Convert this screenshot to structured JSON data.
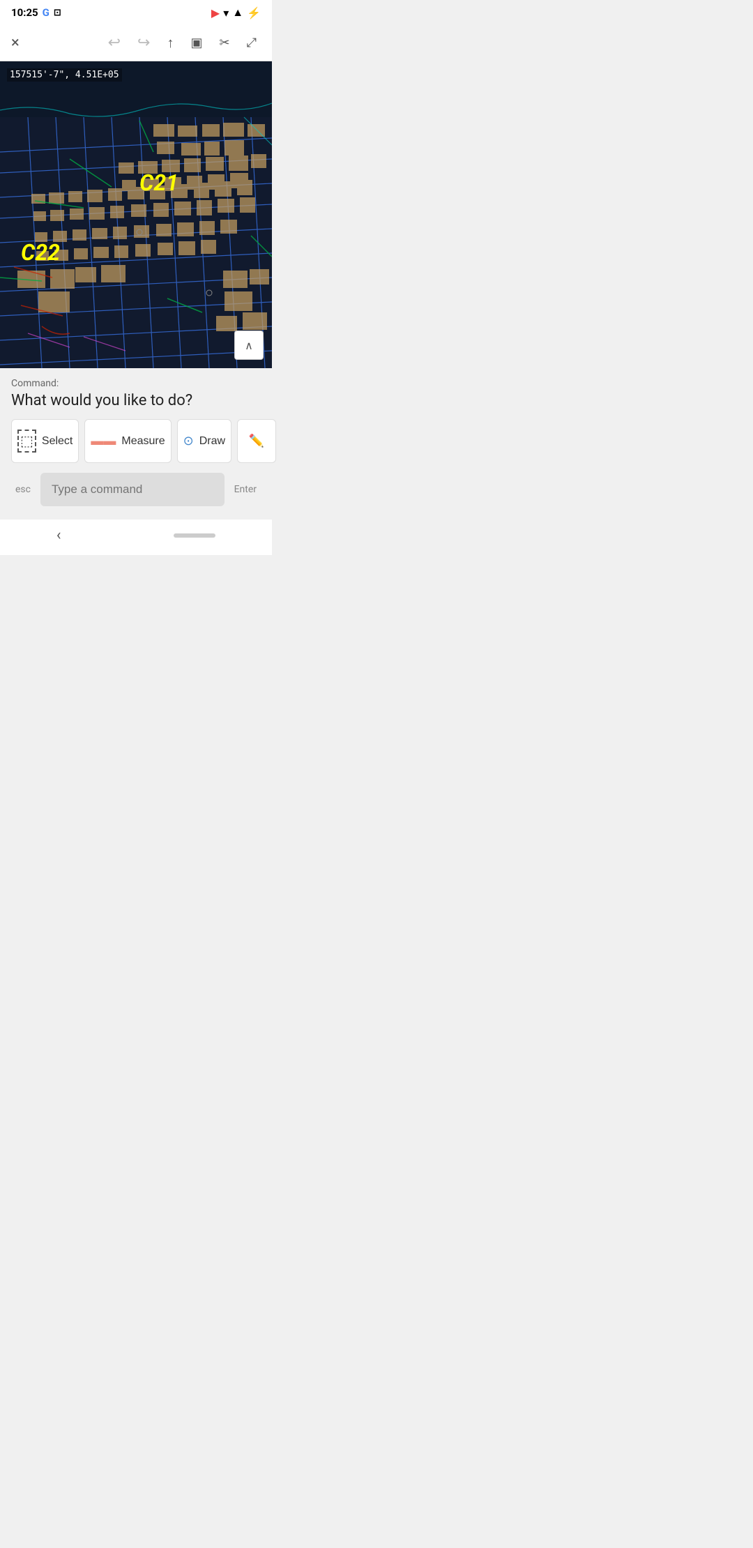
{
  "status_bar": {
    "time": "10:25",
    "icons": [
      "G",
      "screen-record",
      "cast",
      "wifi",
      "signal",
      "battery"
    ]
  },
  "toolbar": {
    "close_label": "×",
    "undo_label": "↩",
    "redo_label": "↪",
    "share_label": "↑",
    "save_label": "💾",
    "trim_label": "✂",
    "fullscreen_label": "⤢"
  },
  "cad_view": {
    "coords": "157515'-7\", 4.51E+05",
    "zone_labels": [
      {
        "id": "C21",
        "class": "zone-c21"
      },
      {
        "id": "C22",
        "class": "zone-c22"
      }
    ]
  },
  "command_area": {
    "label": "Command:",
    "question": "What would you like to do?",
    "buttons": [
      {
        "id": "select",
        "icon": "⬚",
        "label": "Select"
      },
      {
        "id": "measure",
        "icon": "📏",
        "label": "Measure"
      },
      {
        "id": "draw",
        "icon": "⊙",
        "label": "Draw"
      },
      {
        "id": "more",
        "icon": "✏",
        "label": ""
      }
    ],
    "input_placeholder": "Type a command",
    "esc_label": "esc",
    "enter_label": "Enter"
  },
  "nav_bar": {
    "back_label": "‹"
  }
}
